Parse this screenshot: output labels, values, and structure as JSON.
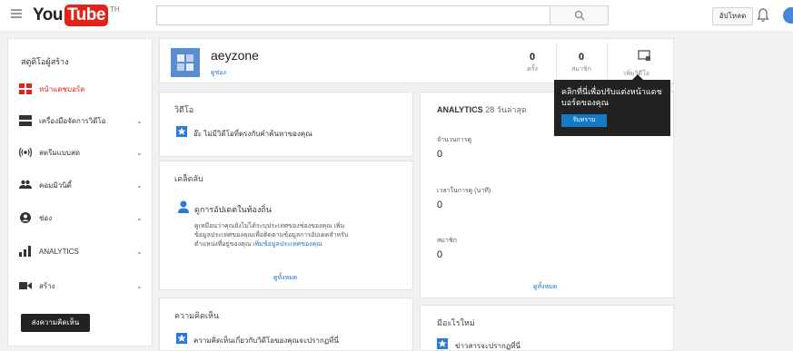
{
  "header": {
    "logo_you": "You",
    "logo_tube": "Tube",
    "logo_region": "TH",
    "search_placeholder": "",
    "upload_label": "อัปโหลด"
  },
  "sidebar": {
    "title": "สตูดิโอผู้สร้าง",
    "items": [
      {
        "label": "หน้าแดชบอร์ด",
        "icon": "dashboard-icon",
        "active": true
      },
      {
        "label": "เครื่องมือจัดการวิดีโอ",
        "icon": "video-manager-icon"
      },
      {
        "label": "สตรีมแบบสด",
        "icon": "live-icon"
      },
      {
        "label": "คอมมิวนิตี้",
        "icon": "community-icon"
      },
      {
        "label": "ช่อง",
        "icon": "channel-icon"
      },
      {
        "label": "ANALYTICS",
        "icon": "analytics-icon"
      },
      {
        "label": "สร้าง",
        "icon": "create-icon"
      }
    ],
    "feedback_label": "ส่งความคิดเห็น"
  },
  "channel": {
    "name": "aeyzone",
    "sub_link": "ดูช่อง",
    "stats": [
      {
        "num": "0",
        "cap": "ครั้ง"
      },
      {
        "num": "0",
        "cap": "สมาชิก"
      }
    ],
    "customize_label": "เพิ่มวิดีโอ"
  },
  "videos_card": {
    "title": "วิดีโอ",
    "message": "อ๊ะ ไม่มีวิดีโอที่ตรงกับคำค้นหาของคุณ"
  },
  "tips_card": {
    "title": "เคล็ดลับ",
    "heading": "ดูการอัปเดตในท้องถิ่น",
    "body1": "ดูเหมือนว่าคุณยังไม่ได้ระบุประเทศของช่องของคุณ เพิ่ม",
    "body2": "ข้อมูลประเทศของคุณเพื่อติดตามข้อมูลการอัปเดตสำหรับ",
    "body3": "ตำแหน่งที่อยู่ของคุณ",
    "body_link": "เพิ่มข้อมูลประเทศของคุณ",
    "see_all": "ดูทั้งหมด"
  },
  "comments_card": {
    "title": "ความคิดเห็น",
    "message": "ความคิดเห็นเกี่ยวกับวิดีโอของคุณจะปรากฏที่นี่"
  },
  "analytics_card": {
    "title": "ANALYTICS",
    "period": "28 วันล่าสุด",
    "metrics": [
      {
        "label": "จำนวนการดู",
        "value": "0"
      },
      {
        "label": "เวลาในการดู (นาที)",
        "value": "0"
      },
      {
        "label": "สมาชิก",
        "value": "0"
      }
    ],
    "see_all": "ดูทั้งหมด"
  },
  "whats_new_card": {
    "title": "มีอะไรใหม่",
    "message": "ข่าวสารจะปรากฏที่นี่"
  },
  "tooltip": {
    "text": "คลิกที่นี่เพื่อปรับแต่งหน้าแดชบอร์ดของคุณ",
    "button": "รับทราบ"
  }
}
